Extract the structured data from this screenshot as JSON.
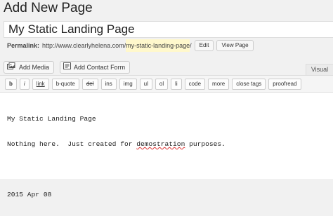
{
  "header": {
    "title": "Add New Page"
  },
  "post": {
    "title": "My Static Landing Page"
  },
  "permalink": {
    "label": "Permalink:",
    "base": "http://www.clearlyhelena.com/",
    "slug": "my-static-landing-page",
    "trail": "/",
    "edit_label": "Edit",
    "view_label": "View Page"
  },
  "media_buttons": [
    {
      "label": "Add Media",
      "icon": "media-icon"
    },
    {
      "label": "Add Contact Form",
      "icon": "contact-form-icon"
    }
  ],
  "editor_tabs": {
    "visual": "Visual"
  },
  "quicktags": [
    "b",
    "i",
    "link",
    "b-quote",
    "del",
    "ins",
    "img",
    "ul",
    "ol",
    "li",
    "code",
    "more",
    "close tags",
    "proofread"
  ],
  "content": {
    "line1": "My Static Landing Page",
    "line2_pre": "Nothing here.  Just created for ",
    "line2_word": "demostration",
    "line2_post": " purposes.",
    "line3": "",
    "line4": "2015 Apr 08"
  }
}
